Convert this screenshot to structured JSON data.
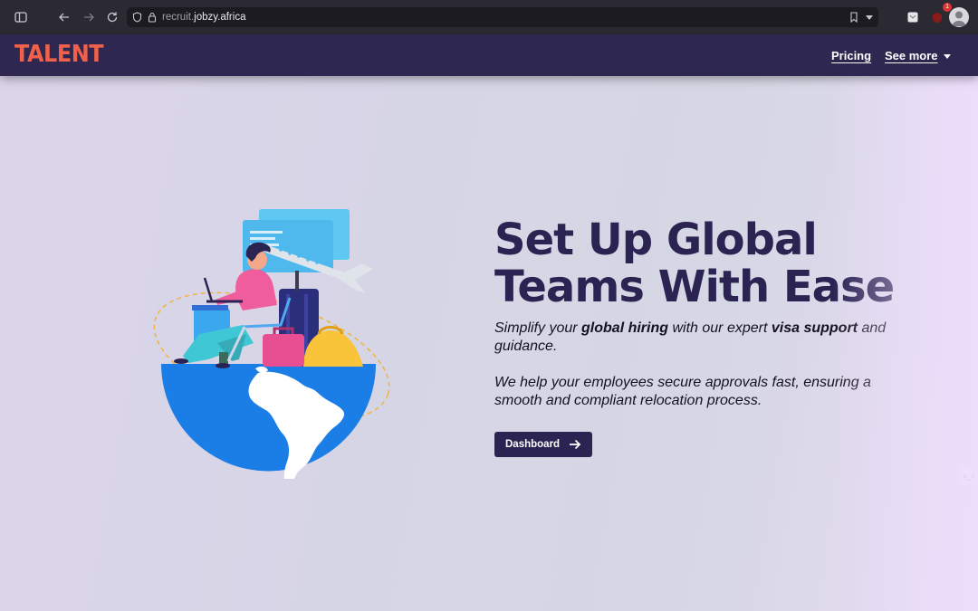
{
  "browser": {
    "url_prefix": "recruit.",
    "url_domain": "jobzy.africa",
    "extension_badge": "1",
    "icons": [
      "sidebar-icon",
      "back-icon",
      "forward-icon",
      "reload-icon",
      "shield-icon",
      "lock-icon",
      "bookmark-icon",
      "chevron-down-icon",
      "extension-icon",
      "ublock-icon",
      "profile-avatar"
    ]
  },
  "nav": {
    "logo": "TALENT",
    "links": {
      "pricing": "Pricing",
      "see_more": "See more"
    }
  },
  "hero": {
    "title_line1": "Set Up Global",
    "title_line2": "Teams With Ease",
    "p1_a": "Simplify your ",
    "p1_b": "global hiring",
    "p1_c": " with our expert ",
    "p1_d": "visa support",
    "p1_e": " and guidance.",
    "p2": "We help your employees secure approvals fast, ensuring a smooth and compliant relocation process.",
    "button": "Dashboard"
  },
  "side_widget": ">_<",
  "colors": {
    "nav_bg": "#2e2750",
    "logo": "#f0614c",
    "title": "#2b2452",
    "button_bg": "#2b2452",
    "globe_blue": "#1b7de6"
  }
}
